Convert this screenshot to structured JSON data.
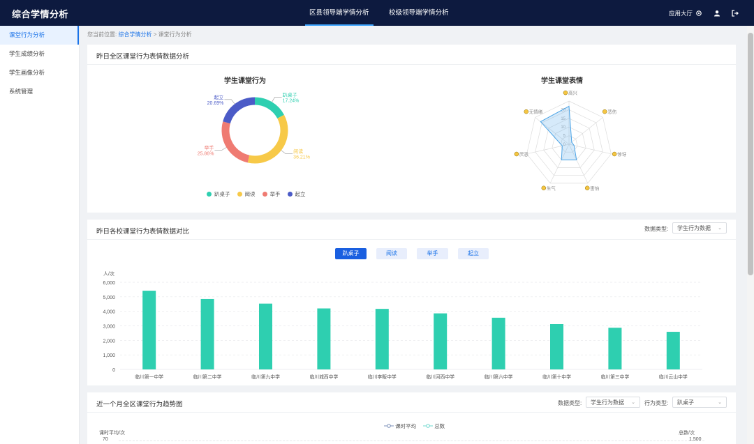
{
  "app": {
    "title": "综合学情分析",
    "tabs": [
      "区县领导端学情分析",
      "校级领导端学情分析"
    ],
    "app_hall": "应用大厅"
  },
  "sidebar": {
    "items": [
      {
        "label": "课堂行为分析",
        "active": true
      },
      {
        "label": "学生成绩分析",
        "active": false
      },
      {
        "label": "学生画像分析",
        "active": false
      },
      {
        "label": "系统管理",
        "active": false
      }
    ]
  },
  "breadcrumb": {
    "prefix": "您当前位置:",
    "link": "综合学情分析",
    "sep": ">",
    "current": "课堂行为分析"
  },
  "section1": {
    "title": "昨日全区课堂行为表情数据分析",
    "donut": {
      "title": "学生课堂行为",
      "slices": [
        {
          "name": "趴桌子",
          "pct": "17.24%",
          "value": 17.24,
          "color": "#2ecfb0"
        },
        {
          "name": "阅读",
          "pct": "36.21%",
          "value": 36.21,
          "color": "#f7c948"
        },
        {
          "name": "举手",
          "pct": "25.86%",
          "value": 25.86,
          "color": "#ef7b72"
        },
        {
          "name": "起立",
          "pct": "20.69%",
          "value": 20.69,
          "color": "#4b5bc7"
        }
      ]
    },
    "radar": {
      "title": "学生课堂表情",
      "axes": [
        "高兴",
        "悲伤",
        "惊讶",
        "害怕",
        "生气",
        "厌恶",
        "无情绪"
      ],
      "values": [
        22,
        2,
        3,
        10,
        10,
        4,
        21
      ],
      "max": 25,
      "ticks": [
        "0",
        "5",
        "10",
        "15",
        "20"
      ]
    }
  },
  "section2": {
    "title": "昨日各校课堂行为表情数据对比",
    "data_type_label": "数据类型:",
    "data_type_value": "学生行为数据",
    "buttons": [
      "趴桌子",
      "阅读",
      "举手",
      "起立"
    ],
    "active_button": 0
  },
  "chart_data": {
    "type": "bar",
    "ylabel": "人/次",
    "ylim": [
      0,
      6000
    ],
    "yticks": [
      "0",
      "1,000",
      "2,000",
      "3,000",
      "4,000",
      "5,000",
      "6,000"
    ],
    "categories": [
      "临川第一中学",
      "临川第二中学",
      "临川第九中学",
      "临川城西中学",
      "临川李畈中学",
      "临川河西中学",
      "临川第六中学",
      "临川第十中学",
      "临川第三中学",
      "临川云山中学"
    ],
    "values": [
      5420,
      4850,
      4530,
      4200,
      4170,
      3860,
      3560,
      3120,
      2870,
      2590
    ],
    "color": "#2ecfb0",
    "grid": true
  },
  "section3": {
    "title": "近一个月全区课堂行为趋势图",
    "data_type_label": "数据类型:",
    "data_type_value": "学生行为数据",
    "behavior_label": "行为类型:",
    "behavior_value": "趴桌子",
    "legend": [
      "课时平均",
      "总数"
    ],
    "left_axis_label": "课时平均/次",
    "right_axis_label": "总数/次",
    "left_top_tick": "70",
    "right_top_tick": "1,500"
  },
  "colors": {
    "header": "#0d1a3f",
    "accent": "#1a73e8",
    "bar": "#2ecfb0"
  }
}
